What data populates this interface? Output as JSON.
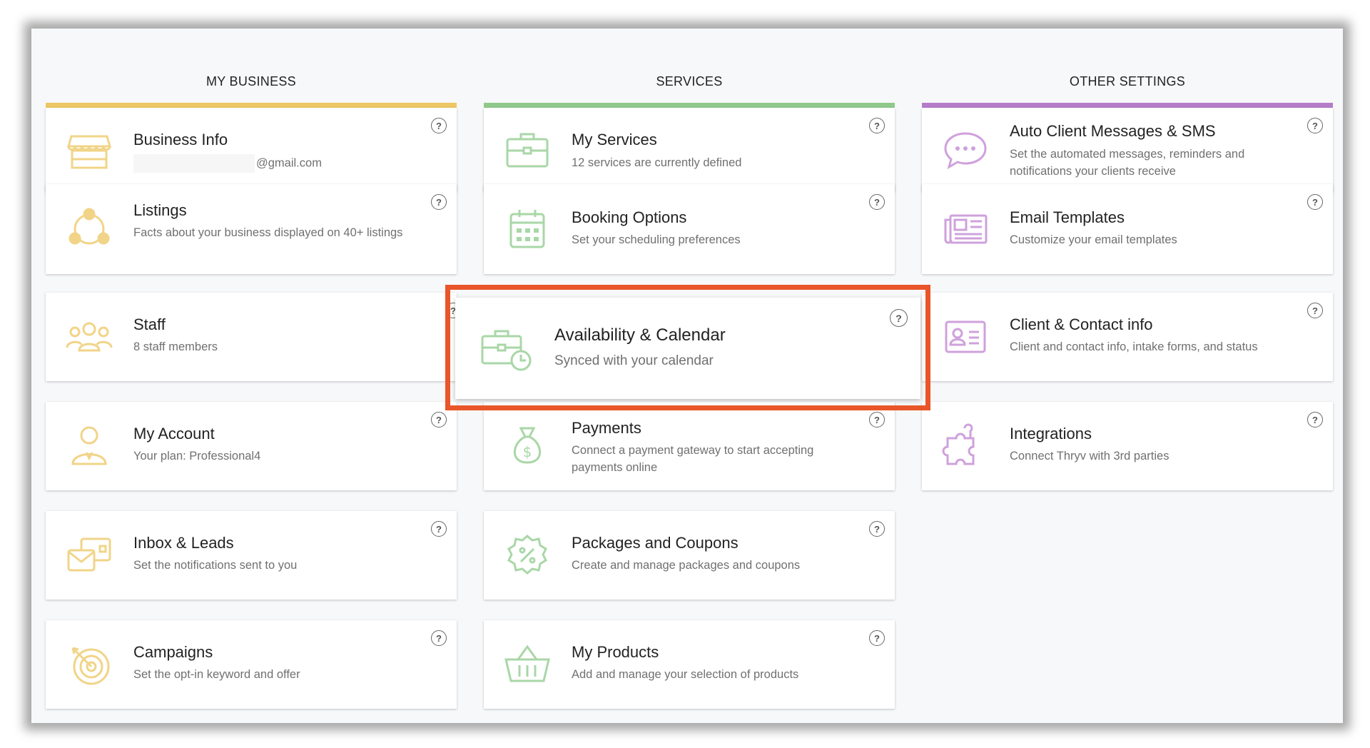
{
  "columns": [
    {
      "header": "MY BUSINESS",
      "accent": "#ecc763",
      "icon_color": "#f1d488"
    },
    {
      "header": "SERVICES",
      "accent": "#8fca8c",
      "icon_color": "#a9d7a7"
    },
    {
      "header": "OTHER SETTINGS",
      "accent": "#b57cc9",
      "icon_color": "#cfa1dc"
    }
  ],
  "my_business": [
    {
      "title": "Business Info",
      "desc": "@gmail.com",
      "icon": "storefront-icon"
    },
    {
      "title": "Listings",
      "desc": "Facts about your business displayed on 40+ listings",
      "icon": "network-icon"
    },
    {
      "title": "Staff",
      "desc": "8 staff members",
      "icon": "people-icon"
    },
    {
      "title": "My Account",
      "desc": "Your plan: Professional4",
      "icon": "user-tie-icon"
    },
    {
      "title": "Inbox & Leads",
      "desc": "Set the notifications sent to you",
      "icon": "mail-card-icon"
    },
    {
      "title": "Campaigns",
      "desc": "Set the opt-in keyword and offer",
      "icon": "target-icon"
    }
  ],
  "services": [
    {
      "title": "My Services",
      "desc": "12 services are currently defined",
      "icon": "briefcase-icon"
    },
    {
      "title": "Booking Options",
      "desc": "Set your scheduling preferences",
      "icon": "calendar-icon"
    },
    {
      "title": "Payments",
      "desc": "Connect a payment gateway to start accepting payments online",
      "icon": "money-bag-icon"
    },
    {
      "title": "Packages and Coupons",
      "desc": "Create and manage packages and coupons",
      "icon": "coupon-icon"
    },
    {
      "title": "My Products",
      "desc": "Add and manage your selection of products",
      "icon": "basket-icon"
    }
  ],
  "other_settings": [
    {
      "title": "Auto Client Messages & SMS",
      "desc": "Set the automated messages, reminders and notifications your clients receive",
      "icon": "chat-bubble-icon"
    },
    {
      "title": "Email Templates",
      "desc": "Customize your email templates",
      "icon": "newspaper-icon"
    },
    {
      "title": "Client & Contact info",
      "desc": "Client and contact info, intake forms, and status",
      "icon": "id-card-icon"
    },
    {
      "title": "Integrations",
      "desc": "Connect Thryv with 3rd parties",
      "icon": "puzzle-icon"
    }
  ],
  "highlighted": {
    "title": "Availability & Calendar",
    "desc": "Synced with your calendar",
    "icon": "briefcase-clock-icon",
    "border_color": "#e8562a"
  },
  "help_glyph": "?"
}
